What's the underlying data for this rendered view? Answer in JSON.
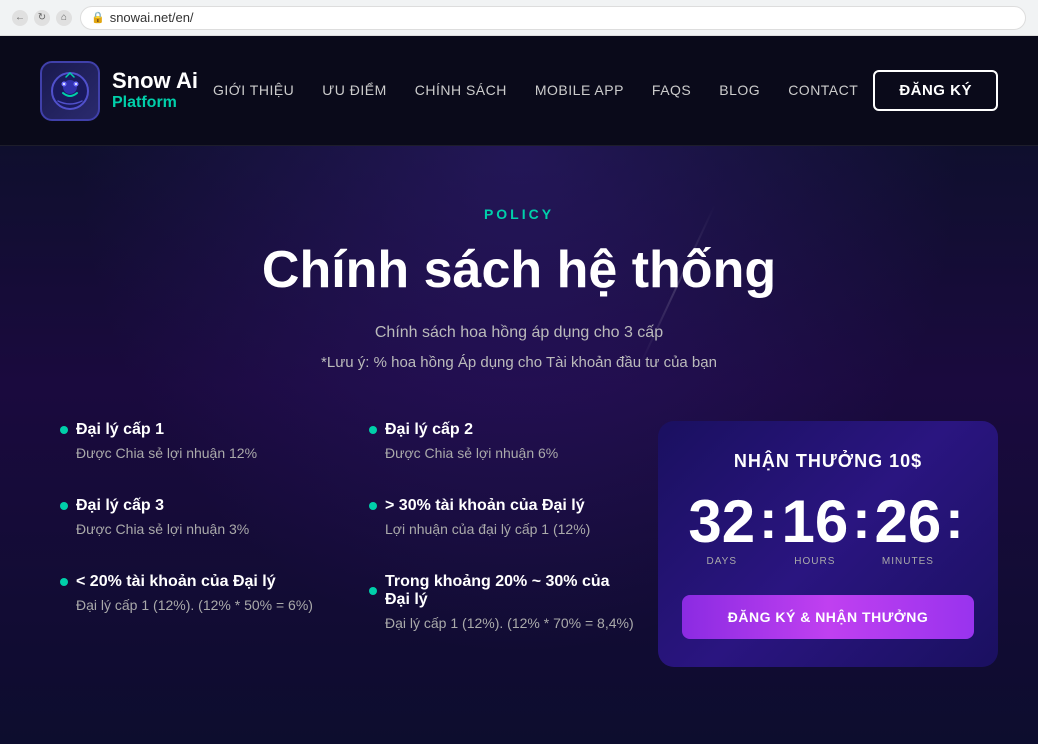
{
  "browser": {
    "url": "snowai.net/en/"
  },
  "navbar": {
    "logo_name": "Snow Ai",
    "logo_sub": "Platform",
    "links": [
      {
        "label": "GIỚI THIỆU",
        "href": "#"
      },
      {
        "label": "ƯU ĐIỂM",
        "href": "#"
      },
      {
        "label": "CHÍNH SÁCH",
        "href": "#",
        "active": true
      },
      {
        "label": "MOBILE APP",
        "href": "#"
      },
      {
        "label": "FAQS",
        "href": "#"
      },
      {
        "label": "BLOG",
        "href": "#"
      },
      {
        "label": "CONTACT",
        "href": "#"
      }
    ],
    "register_btn": "ĐĂNG KÝ"
  },
  "hero": {
    "policy_label": "POLICY",
    "title": "Chính sách hệ thống",
    "subtitle": "Chính sách hoa hồng áp dụng cho 3 cấp",
    "note": "*Lưu ý: % hoa hồng Áp dụng cho Tài khoản đầu tư của bạn"
  },
  "agents_left": [
    {
      "name": "Đại lý cấp 1",
      "desc": "Được Chia sẻ lợi nhuận 12%"
    },
    {
      "name": "Đại lý cấp 3",
      "desc": "Được Chia sẻ lợi nhuận 3%"
    },
    {
      "name": "< 20% tài khoản của Đại lý",
      "desc": "Đại lý cấp 1 (12%). (12% * 50% = 6%)"
    }
  ],
  "agents_right": [
    {
      "name": "Đại lý cấp 2",
      "desc": "Được Chia sẻ lợi nhuận 6%"
    },
    {
      "name": "> 30% tài khoản của Đại lý",
      "desc": "Lợi nhuận của đại lý cấp 1 (12%)"
    },
    {
      "name": "Trong khoảng 20% ~ 30% của Đại lý",
      "desc": "Đại lý cấp 1 (12%). (12% * 70% = 8,4%)"
    }
  ],
  "timer": {
    "title": "NHẬN THƯỞNG 10$",
    "days": "32",
    "hours": "16",
    "minutes": "26",
    "days_label": "DAYS",
    "hours_label": "HOURS",
    "minutes_label": "MINUTES",
    "claim_btn": "ĐĂNG KÝ & NHẬN THƯỞNG"
  }
}
